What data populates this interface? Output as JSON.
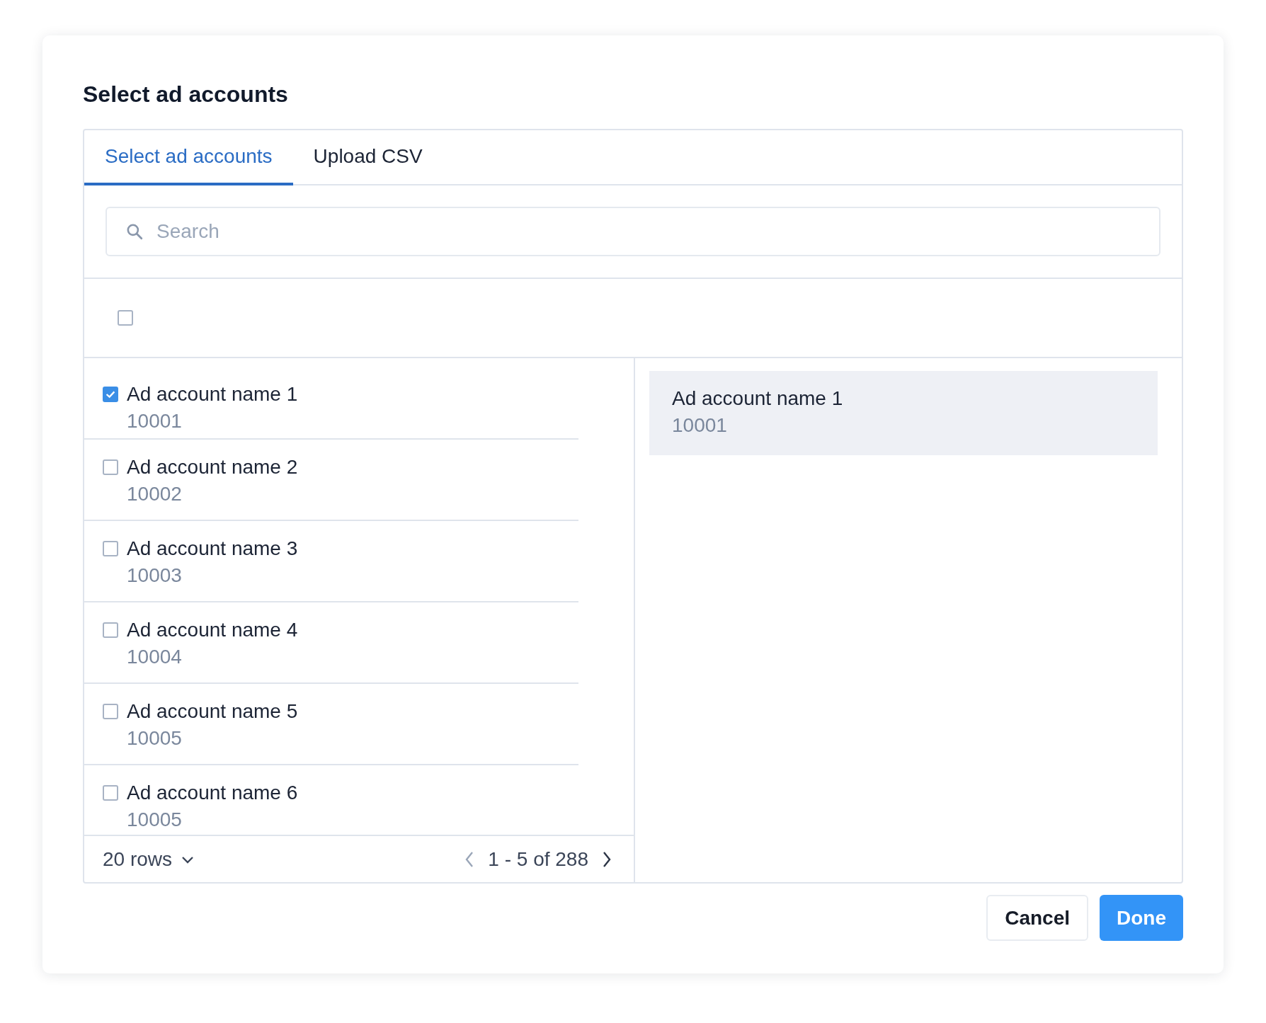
{
  "dialog": {
    "title": "Select ad accounts"
  },
  "tabs": [
    {
      "label": "Select ad accounts",
      "selected": true
    },
    {
      "label": "Upload CSV",
      "selected": false
    }
  ],
  "search": {
    "placeholder": "Search"
  },
  "select_all": {
    "checked": false
  },
  "accounts": [
    {
      "name": "Ad account name 1",
      "id": "10001",
      "checked": true
    },
    {
      "name": "Ad account name 2",
      "id": "10002",
      "checked": false
    },
    {
      "name": "Ad account name 3",
      "id": "10003",
      "checked": false
    },
    {
      "name": "Ad account name 4",
      "id": "10004",
      "checked": false
    },
    {
      "name": "Ad account name 5",
      "id": "10005",
      "checked": false
    },
    {
      "name": "Ad account name 6",
      "id": "10005",
      "checked": false
    }
  ],
  "pagination": {
    "rows_per_page": "20 rows",
    "range": "1 - 5 of 288"
  },
  "selected_accounts": [
    {
      "name": "Ad account name 1",
      "id": "10001"
    }
  ],
  "buttons": [
    {
      "label": "Cancel",
      "kind": "secondary"
    },
    {
      "label": "Done",
      "kind": "primary"
    }
  ]
}
